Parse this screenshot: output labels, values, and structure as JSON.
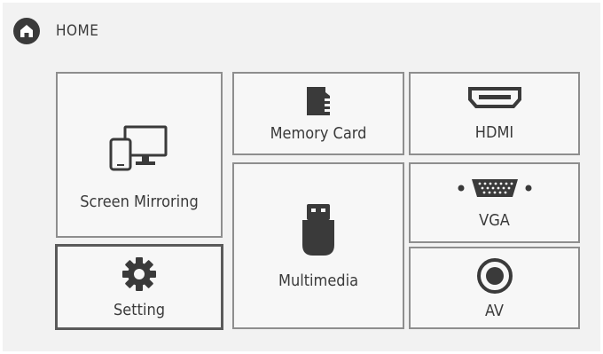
{
  "header": {
    "title": "HOME",
    "icon": "home-icon"
  },
  "tiles": {
    "screen_mirroring": {
      "label": "Screen Mirroring",
      "icon": "devices-icon"
    },
    "memory_card": {
      "label": "Memory Card",
      "icon": "sd-card-icon"
    },
    "hdmi": {
      "label": "HDMI",
      "icon": "hdmi-port-icon"
    },
    "vga": {
      "label": "VGA",
      "icon": "vga-port-icon"
    },
    "multimedia": {
      "label": "Multimedia",
      "icon": "usb-drive-icon"
    },
    "setting": {
      "label": "Setting",
      "icon": "gear-icon",
      "selected": true
    },
    "av": {
      "label": "AV",
      "icon": "av-jack-icon"
    }
  },
  "colors": {
    "background": "#f2f2f2",
    "tile_border": "#8e8e8e",
    "icon": "#3a3a3a"
  }
}
